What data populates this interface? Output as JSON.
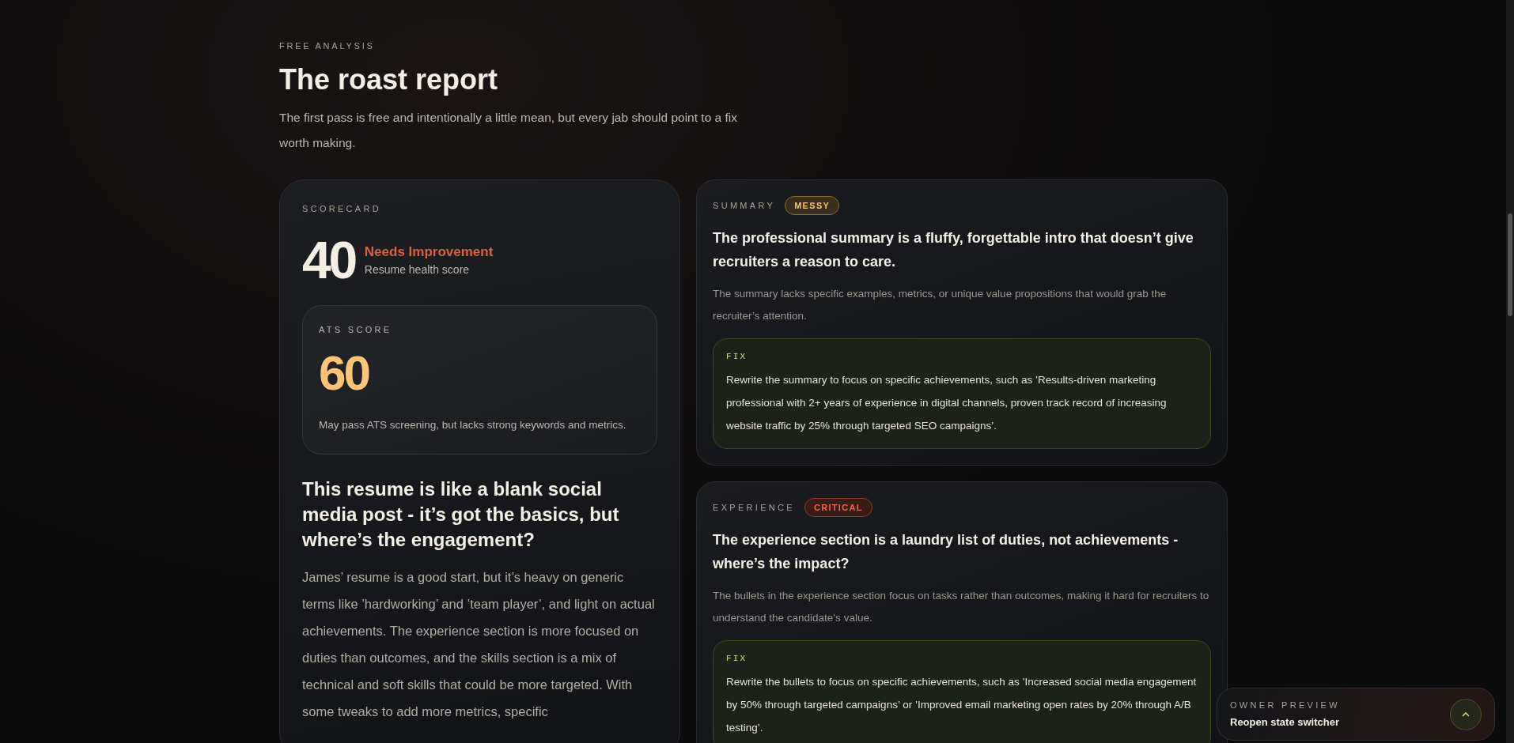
{
  "header": {
    "eyebrow": "FREE ANALYSIS",
    "title": "The roast report",
    "subtitle": "The first pass is free and intentionally a little mean, but every jab should point to a fix worth making."
  },
  "scorecard": {
    "label": "SCORECARD",
    "score": "40",
    "rating": "Needs Improvement",
    "score_caption": "Resume health score",
    "ats": {
      "label": "ATS SCORE",
      "score": "60",
      "note": "May pass ATS screening, but lacks strong keywords and metrics."
    },
    "headline": "This resume is like a blank social media post - it’s got the basics, but where’s the engagement?",
    "body": "James’ resume is a good start, but it’s heavy on generic terms like ’hardworking’ and ’team player’, and light on actual achievements. The experience section is more focused on duties than outcomes, and the skills section is a mix of technical and soft skills that could be more targeted. With some tweaks to add more metrics, specific"
  },
  "sections": [
    {
      "label": "SUMMARY",
      "badge": "MESSY",
      "kind": "messy",
      "title": "The professional summary is a fluffy, forgettable intro that doesn’t give recruiters a reason to care.",
      "detail": "The summary lacks specific examples, metrics, or unique value propositions that would grab the recruiter’s attention.",
      "fix_label": "FIX",
      "fix": "Rewrite the summary to focus on specific achievements, such as ’Results-driven marketing professional with 2+ years of experience in digital channels, proven track record of increasing website traffic by 25% through targeted SEO campaigns’."
    },
    {
      "label": "EXPERIENCE",
      "badge": "CRITICAL",
      "kind": "critical",
      "title": "The experience section is a laundry list of duties, not achievements - where’s the impact?",
      "detail": "The bullets in the experience section focus on tasks rather than outcomes, making it hard for recruiters to understand the candidate’s value.",
      "fix_label": "FIX",
      "fix": "Rewrite the bullets to focus on specific achievements, such as ’Increased social media engagement by 50% through targeted campaigns’ or ’Improved email marketing open rates by 20% through A/B testing’."
    }
  ],
  "owner_preview": {
    "label": "OWNER PREVIEW",
    "action": "Reopen state switcher"
  }
}
